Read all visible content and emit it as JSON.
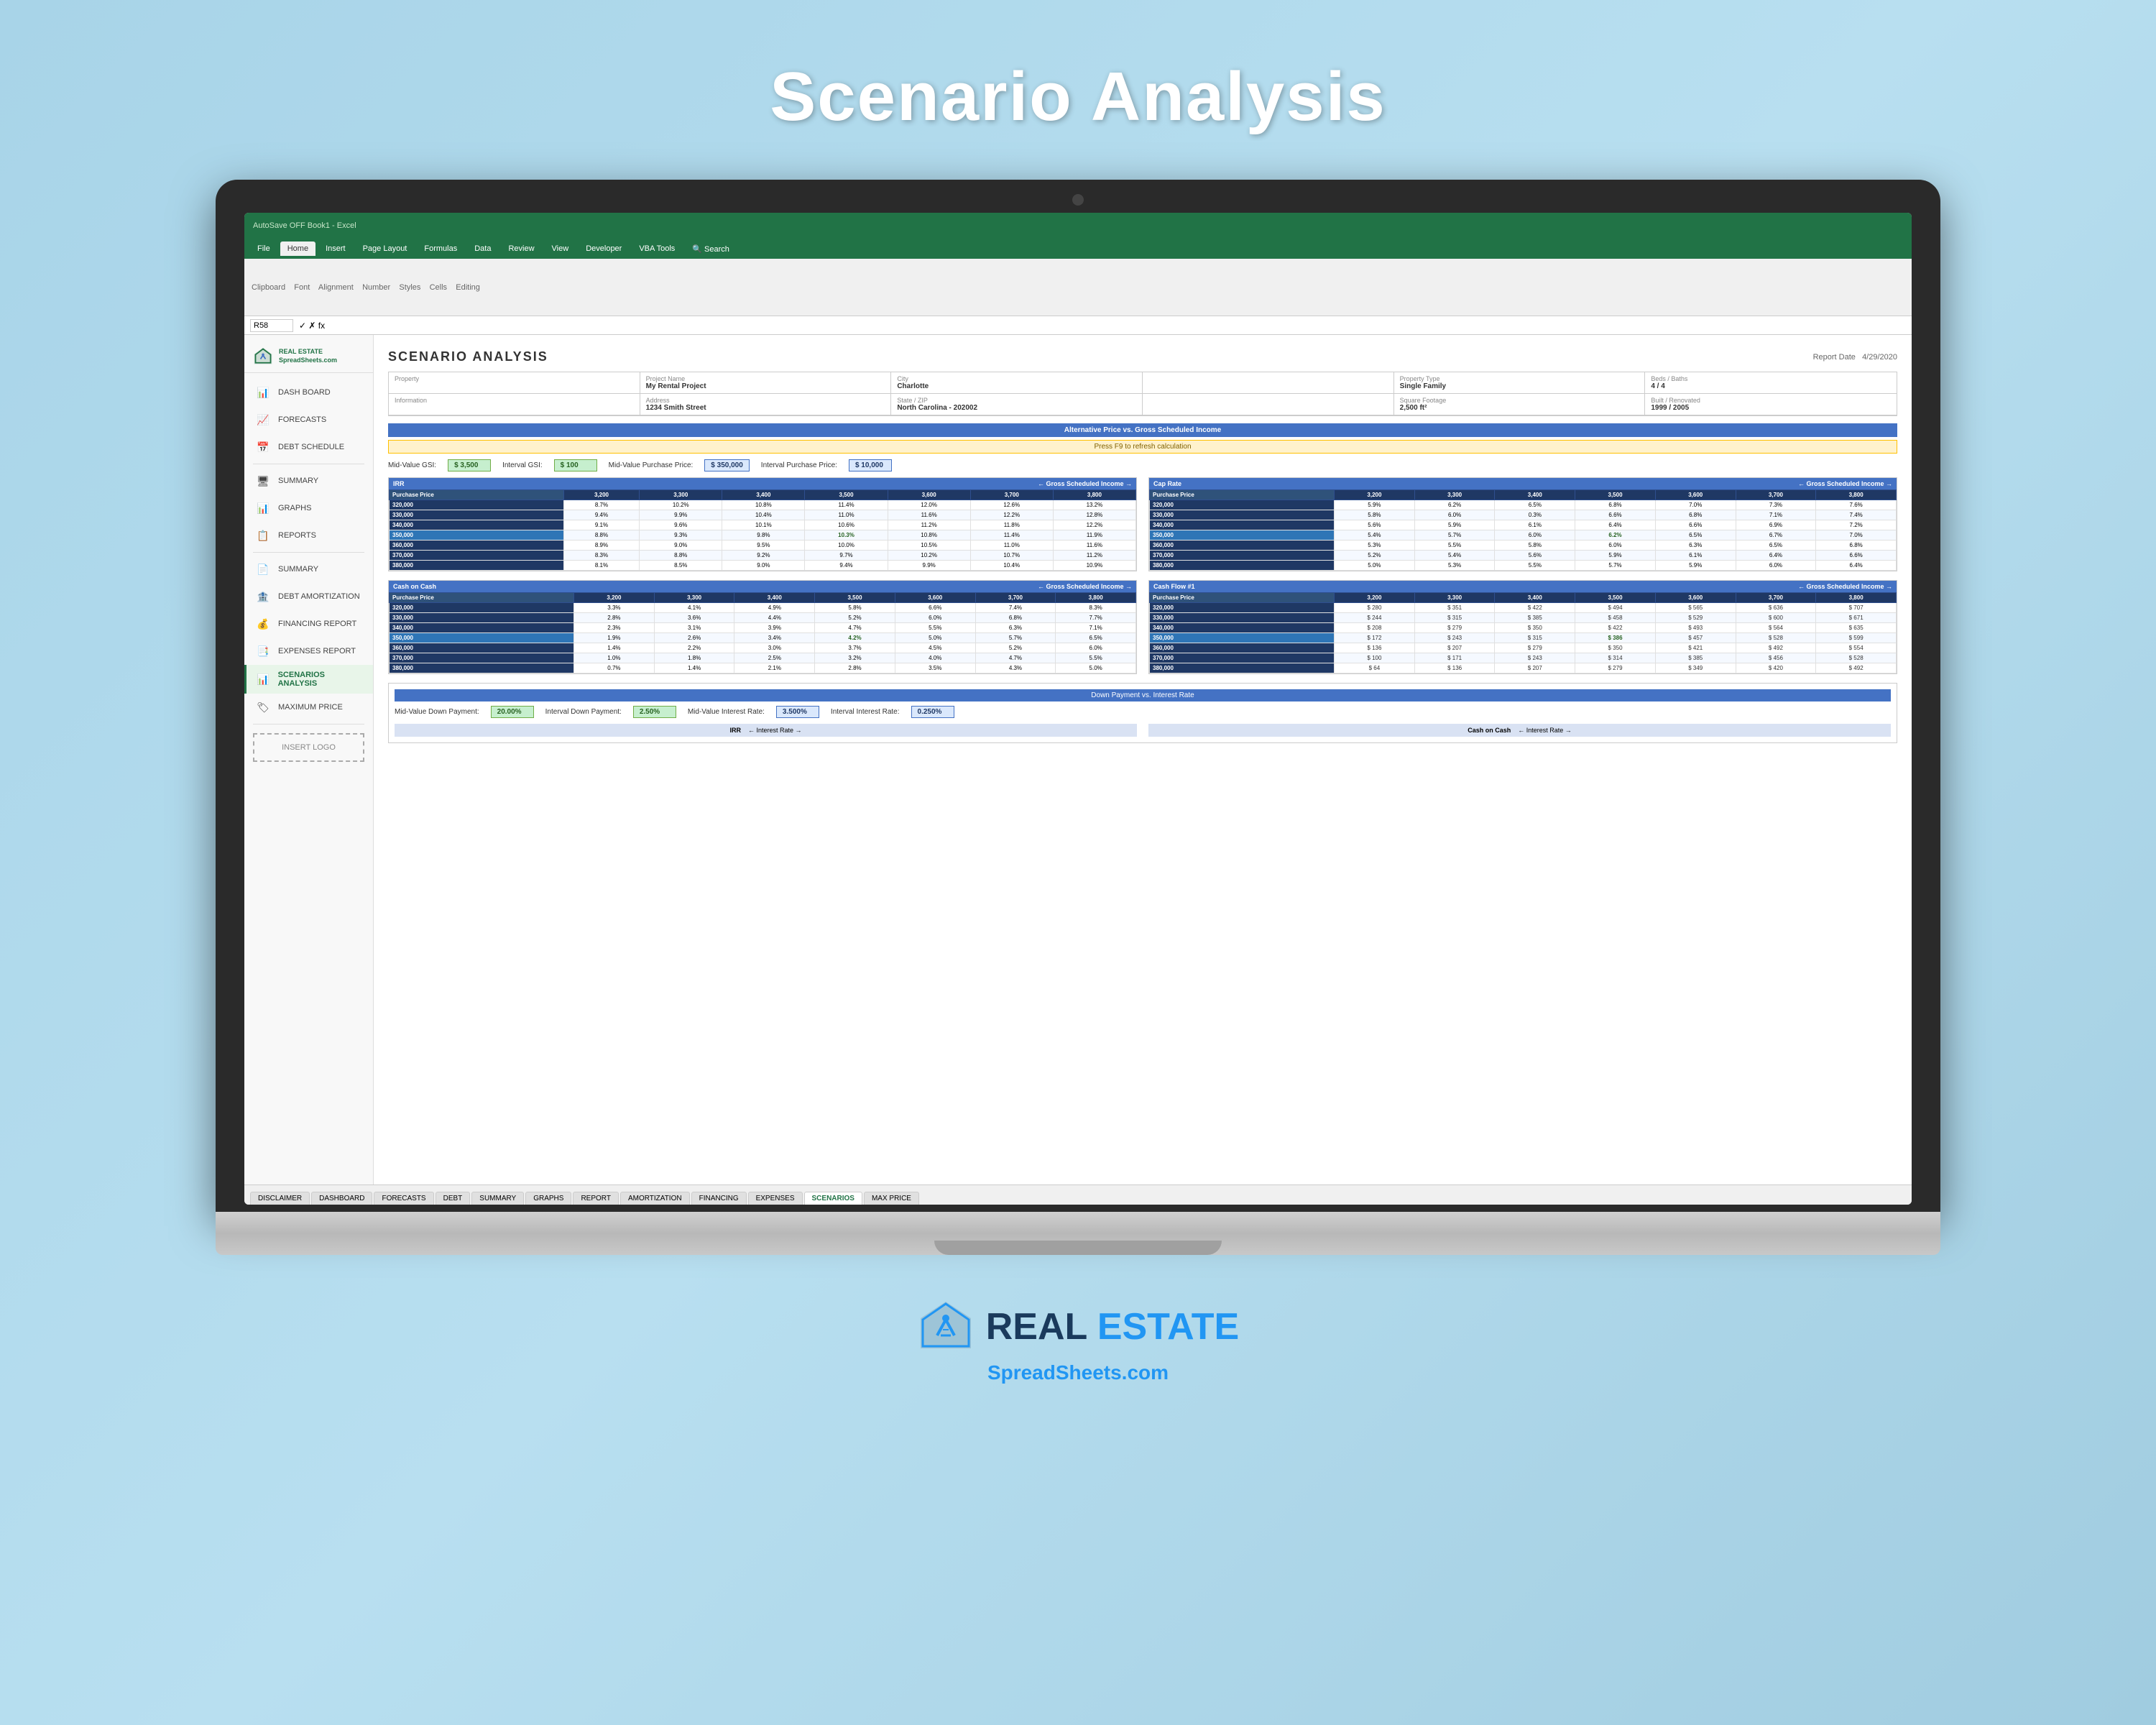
{
  "page": {
    "title": "Scenario Analysis"
  },
  "excel": {
    "title_bar": "AutoSave  OFF  Book1 - Excel",
    "cell_ref": "R58",
    "tabs": [
      "File",
      "Home",
      "Insert",
      "Page Layout",
      "Formulas",
      "Data",
      "Review",
      "View",
      "Developer",
      "VBA Tools",
      "Search"
    ],
    "active_tab": "Home",
    "sheet_tabs": [
      "DISCLAIMER",
      "DASHBOARD",
      "FORECASTS",
      "DEBT",
      "SUMMARY",
      "GRAPHS",
      "REPORT",
      "AMORTIZATION",
      "FINANCING",
      "EXPENSES",
      "SCENARIOS",
      "MAX PRICE"
    ],
    "active_sheet": "SCENARIOS"
  },
  "sidebar": {
    "logo_text_line1": "REAL ESTATE",
    "logo_text_line2": "SpreadSheets.com",
    "items": [
      {
        "label": "DASH BOARD",
        "icon": "📊"
      },
      {
        "label": "FORECASTS",
        "icon": "📈"
      },
      {
        "label": "DEBT SCHEDULE",
        "icon": "📅"
      },
      {
        "label": "SUMMARY",
        "icon": "🖥"
      },
      {
        "label": "GRAPHS",
        "icon": "📊"
      },
      {
        "label": "REPORTS",
        "icon": "📋"
      },
      {
        "label": "SUMMARY",
        "icon": "📄"
      },
      {
        "label": "DEBT AMORTIZATION",
        "icon": "🏦"
      },
      {
        "label": "FINANCING REPORT",
        "icon": "💰"
      },
      {
        "label": "EXPENSES REPORT",
        "icon": "📑"
      },
      {
        "label": "SCENARIOS ANALYSIS",
        "icon": "📊"
      },
      {
        "label": "MAXIMUM PRICE",
        "icon": "🏷"
      }
    ],
    "insert_logo": "INSERT LOGO"
  },
  "scenario": {
    "title": "SCENARIO ANALYSIS",
    "report_date_label": "Report Date",
    "report_date": "4/29/2020",
    "property": {
      "rows": [
        {
          "cells": [
            {
              "label": "Property",
              "value": ""
            },
            {
              "label": "Project Name",
              "value": "My Rental Project"
            },
            {
              "label": "City",
              "value": "Charlotte"
            },
            {
              "label": "",
              "value": ""
            },
            {
              "label": "Property Type",
              "value": "Single Family"
            },
            {
              "label": "Beds / Baths",
              "value": "4 / 4"
            }
          ]
        },
        {
          "cells": [
            {
              "label": "Information",
              "value": ""
            },
            {
              "label": "Address",
              "value": "1234 Smith Street"
            },
            {
              "label": "State / ZIP",
              "value": "North Carolina - 202002"
            },
            {
              "label": "",
              "value": ""
            },
            {
              "label": "Square Footage",
              "value": "2,500 ft²"
            },
            {
              "label": "Built / Renovated",
              "value": "1999 / 2005"
            }
          ]
        }
      ]
    },
    "section_header_irr": "Alternative Price vs. Gross Scheduled Income",
    "press_f9": "Press F9 to refresh calculation",
    "inputs": {
      "mid_value_gsi_label": "Mid-Value GSI:",
      "mid_value_gsi": "$ 3,500",
      "interval_gsi_label": "Interval GSI:",
      "interval_gsi": "$ 100",
      "mid_value_purchase_label": "Mid-Value Purchase Price:",
      "mid_value_purchase": "$ 350,000",
      "interval_purchase_label": "Interval Purchase Price:",
      "interval_purchase": "$ 10,000"
    },
    "irr_table": {
      "title": "IRR",
      "subtitle": "← Gross Scheduled Income →",
      "col_headers": [
        "Purchase Price",
        "3,200",
        "3,300",
        "3,400",
        "3,500",
        "3,600",
        "3,700",
        "3,800"
      ],
      "rows": [
        {
          "price": "320,000",
          "vals": [
            "8.7%",
            "10.2%",
            "10.8%",
            "11.4%",
            "12.0%",
            "12.6%",
            "13.2%"
          ]
        },
        {
          "price": "330,000",
          "vals": [
            "9.4%",
            "9.9%",
            "10.4%",
            "11.0%",
            "11.6%",
            "12.2%",
            "12.8%"
          ]
        },
        {
          "price": "340,000",
          "vals": [
            "9.1%",
            "9.6%",
            "10.1%",
            "10.6%",
            "11.2%",
            "11.8%",
            "12.2%"
          ]
        },
        {
          "price": "350,000",
          "vals": [
            "8.8%",
            "9.3%",
            "9.8%",
            "10.3%",
            "10.8%",
            "11.4%",
            "11.9%"
          ],
          "highlight": true
        },
        {
          "price": "360,000",
          "vals": [
            "8.9%",
            "9.0%",
            "9.5%",
            "10.0%",
            "10.5%",
            "11.0%",
            "11.6%"
          ]
        },
        {
          "price": "370,000",
          "vals": [
            "8.3%",
            "8.8%",
            "9.2%",
            "9.7%",
            "10.2%",
            "10.7%",
            "11.2%"
          ]
        },
        {
          "price": "380,000",
          "vals": [
            "8.1%",
            "8.5%",
            "9.0%",
            "9.4%",
            "9.9%",
            "10.4%",
            "10.9%"
          ]
        }
      ]
    },
    "cap_rate_table": {
      "title": "Cap Rate",
      "subtitle": "← Gross Scheduled Income →",
      "col_headers": [
        "Purchase Price",
        "3,200",
        "3,300",
        "3,400",
        "3,500",
        "3,600",
        "3,700",
        "3,800"
      ],
      "rows": [
        {
          "price": "320,000",
          "vals": [
            "5.9%",
            "6.2%",
            "6.5%",
            "6.8%",
            "7.0%",
            "7.3%",
            "7.6%"
          ]
        },
        {
          "price": "330,000",
          "vals": [
            "5.8%",
            "6.0%",
            "0.3%",
            "6.6%",
            "6.8%",
            "7.1%",
            "7.4%"
          ]
        },
        {
          "price": "340,000",
          "vals": [
            "5.6%",
            "5.9%",
            "6.1%",
            "6.4%",
            "6.6%",
            "6.9%",
            "7.2%"
          ]
        },
        {
          "price": "350,000",
          "vals": [
            "5.4%",
            "5.7%",
            "6.0%",
            "6.2%",
            "6.5%",
            "6.7%",
            "7.0%"
          ],
          "highlight": true
        },
        {
          "price": "360,000",
          "vals": [
            "5.3%",
            "5.5%",
            "5.8%",
            "6.0%",
            "6.3%",
            "6.5%",
            "6.8%"
          ]
        },
        {
          "price": "370,000",
          "vals": [
            "5.2%",
            "5.4%",
            "5.6%",
            "5.9%",
            "6.1%",
            "6.4%",
            "6.6%"
          ]
        },
        {
          "price": "380,000",
          "vals": [
            "5.0%",
            "5.3%",
            "5.5%",
            "5.7%",
            "5.9%",
            "6.0%",
            "6.4%"
          ]
        }
      ]
    },
    "cash_on_cash_table": {
      "title": "Cash on Cash",
      "subtitle": "← Gross Scheduled Income →",
      "col_headers": [
        "Purchase Price",
        "3,200",
        "3,300",
        "3,400",
        "3,500",
        "3,600",
        "3,700",
        "3,800"
      ],
      "rows": [
        {
          "price": "320,000",
          "vals": [
            "3.3%",
            "4.1%",
            "4.9%",
            "5.8%",
            "6.6%",
            "7.4%",
            "8.3%"
          ]
        },
        {
          "price": "330,000",
          "vals": [
            "2.8%",
            "3.6%",
            "4.4%",
            "5.2%",
            "6.0%",
            "6.8%",
            "7.7%"
          ]
        },
        {
          "price": "340,000",
          "vals": [
            "2.3%",
            "3.1%",
            "3.9%",
            "4.7%",
            "5.5%",
            "6.3%",
            "7.1%"
          ]
        },
        {
          "price": "350,000",
          "vals": [
            "1.9%",
            "2.6%",
            "3.4%",
            "4.2%",
            "5.0%",
            "5.7%",
            "6.5%"
          ],
          "highlight": true
        },
        {
          "price": "360,000",
          "vals": [
            "1.4%",
            "2.2%",
            "3.0%",
            "3.7%",
            "4.5%",
            "5.2%",
            "6.0%"
          ]
        },
        {
          "price": "370,000",
          "vals": [
            "1.0%",
            "1.8%",
            "2.5%",
            "3.2%",
            "4.0%",
            "4.7%",
            "5.5%"
          ]
        },
        {
          "price": "380,000",
          "vals": [
            "0.7%",
            "1.4%",
            "2.1%",
            "2.8%",
            "3.5%",
            "4.3%",
            "5.0%"
          ]
        }
      ]
    },
    "cash_flow_table": {
      "title": "Cash Flow #1",
      "subtitle": "← Gross Scheduled Income →",
      "col_headers": [
        "Purchase Price",
        "3,200",
        "3,300",
        "3,400",
        "3,500",
        "3,600",
        "3,700",
        "3,800"
      ],
      "rows": [
        {
          "price": "320,000",
          "vals": [
            "$ 280",
            "$ 351",
            "$ 422",
            "$ 494",
            "$ 565",
            "$ 636",
            "$ 707"
          ]
        },
        {
          "price": "330,000",
          "vals": [
            "$ 244",
            "$ 315",
            "$ 385",
            "$ 458",
            "$ 529",
            "$ 600",
            "$ 671"
          ]
        },
        {
          "price": "340,000",
          "vals": [
            "$ 208",
            "$ 279",
            "$ 350",
            "$ 422",
            "$ 493",
            "$ 564",
            "$ 635"
          ]
        },
        {
          "price": "350,000",
          "vals": [
            "$ 172",
            "$ 243",
            "$ 315",
            "$ 386",
            "$ 457",
            "$ 528",
            "$ 599"
          ],
          "highlight": true
        },
        {
          "price": "360,000",
          "vals": [
            "$ 136",
            "$ 207",
            "$ 279",
            "$ 350",
            "$ 421",
            "$ 492",
            "$ 554"
          ]
        },
        {
          "price": "370,000",
          "vals": [
            "$ 100",
            "$ 171",
            "$ 243",
            "$ 314",
            "$ 385",
            "$ 456",
            "$ 528"
          ]
        },
        {
          "price": "380,000",
          "vals": [
            "$ 64",
            "$ 136",
            "$ 207",
            "$ 279",
            "$ 349",
            "$ 420",
            "$ 492"
          ]
        }
      ]
    },
    "bottom": {
      "header": "Down Payment vs. Interest Rate",
      "mid_down_label": "Mid-Value Down Payment:",
      "mid_down": "20.00%",
      "interval_down_label": "Interval Down Payment:",
      "interval_down": "2.50%",
      "mid_interest_label": "Mid-Value Interest Rate:",
      "mid_interest": "3.500%",
      "interval_interest_label": "Interval Interest Rate:",
      "interval_interest": "0.250%",
      "irr_label": "IRR",
      "interest_rate_label": "← Interest Rate →",
      "coc_label": "Cash on Cash",
      "coc_interest_label": "← Interest Rate →"
    }
  },
  "brand": {
    "name_line1": "REAL ESTATE",
    "name_line2": "SpreadSheets.com"
  }
}
